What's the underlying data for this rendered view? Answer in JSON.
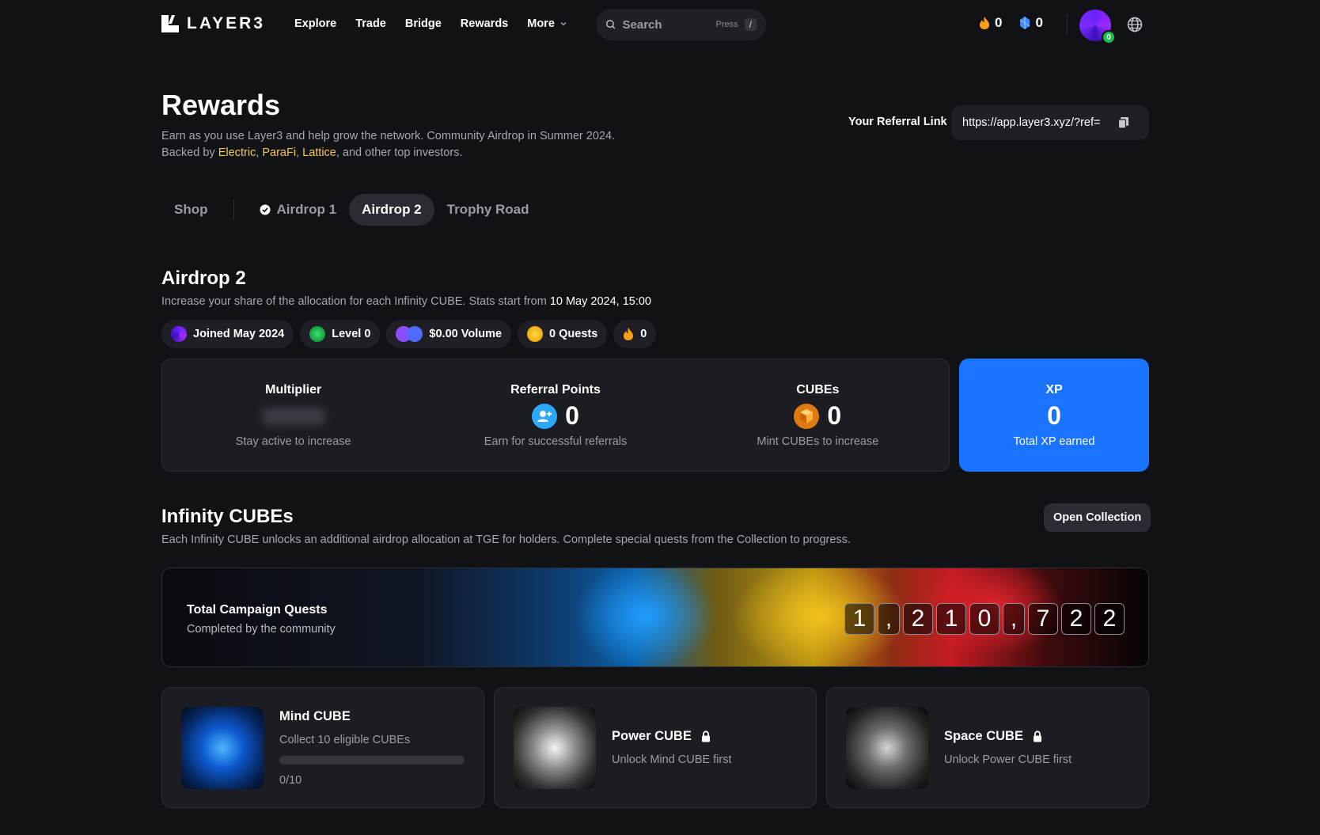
{
  "brand": {
    "name": "LAYER3"
  },
  "nav": [
    {
      "label": "Explore"
    },
    {
      "label": "Trade"
    },
    {
      "label": "Bridge"
    },
    {
      "label": "Rewards"
    },
    {
      "label": "More"
    }
  ],
  "search": {
    "placeholder": "Search",
    "press_label": "Press",
    "shortcut": "/"
  },
  "header_counters": {
    "flames": "0",
    "gems": "0"
  },
  "avatar": {
    "level_badge": "0"
  },
  "page": {
    "title": "Rewards",
    "subtitle_pre": "Earn as you use Layer3 and help grow the network. Community Airdrop in Summer 2024. Backed by ",
    "investors": [
      "Electric",
      "ParaFi",
      "Lattice"
    ],
    "subtitle_post": ", and other top investors."
  },
  "referral": {
    "label": "Your Referral Link",
    "value": "https://app.layer3.xyz/?ref="
  },
  "tabs": [
    {
      "label": "Shop"
    },
    {
      "label": "Airdrop 1"
    },
    {
      "label": "Airdrop 2"
    },
    {
      "label": "Trophy Road"
    }
  ],
  "airdrop2": {
    "title": "Airdrop 2",
    "subtitle": "Increase your share of the allocation for each Infinity CUBE. Stats start from ",
    "start_date": "10 May 2024, 15:00",
    "chips": {
      "joined": "Joined May 2024",
      "level": "Level 0",
      "volume": "$0.00 Volume",
      "quests": "0 Quests",
      "streak": "0"
    },
    "stats": {
      "multiplier": {
        "title": "Multiplier",
        "desc": "Stay active to increase"
      },
      "referral": {
        "title": "Referral Points",
        "value": "0",
        "desc": "Earn for successful referrals"
      },
      "cubes": {
        "title": "CUBEs",
        "value": "0",
        "desc": "Mint CUBEs to increase"
      },
      "xp": {
        "title": "XP",
        "value": "0",
        "desc": "Total XP earned"
      }
    }
  },
  "infinity": {
    "title": "Infinity CUBEs",
    "subtitle": "Each Infinity CUBE unlocks an additional airdrop allocation at TGE for holders. Complete special quests from the Collection to progress.",
    "open_button": "Open Collection",
    "banner": {
      "title": "Total Campaign Quests",
      "desc": "Completed by the community",
      "digits": [
        "1",
        ",",
        "2",
        "1",
        "0",
        ",",
        "7",
        "2",
        "2"
      ]
    },
    "cards": {
      "mind": {
        "title": "Mind CUBE",
        "desc": "Collect 10 eligible CUBEs",
        "progress": "0/10",
        "progress_fraction": 0
      },
      "power": {
        "title": "Power CUBE",
        "desc": "Unlock Mind CUBE first"
      },
      "space": {
        "title": "Space CUBE",
        "desc": "Unlock Power CUBE first"
      }
    }
  },
  "colors": {
    "accent": "#1a73ff",
    "investor_link": "#f7c948",
    "background": "#111216"
  }
}
